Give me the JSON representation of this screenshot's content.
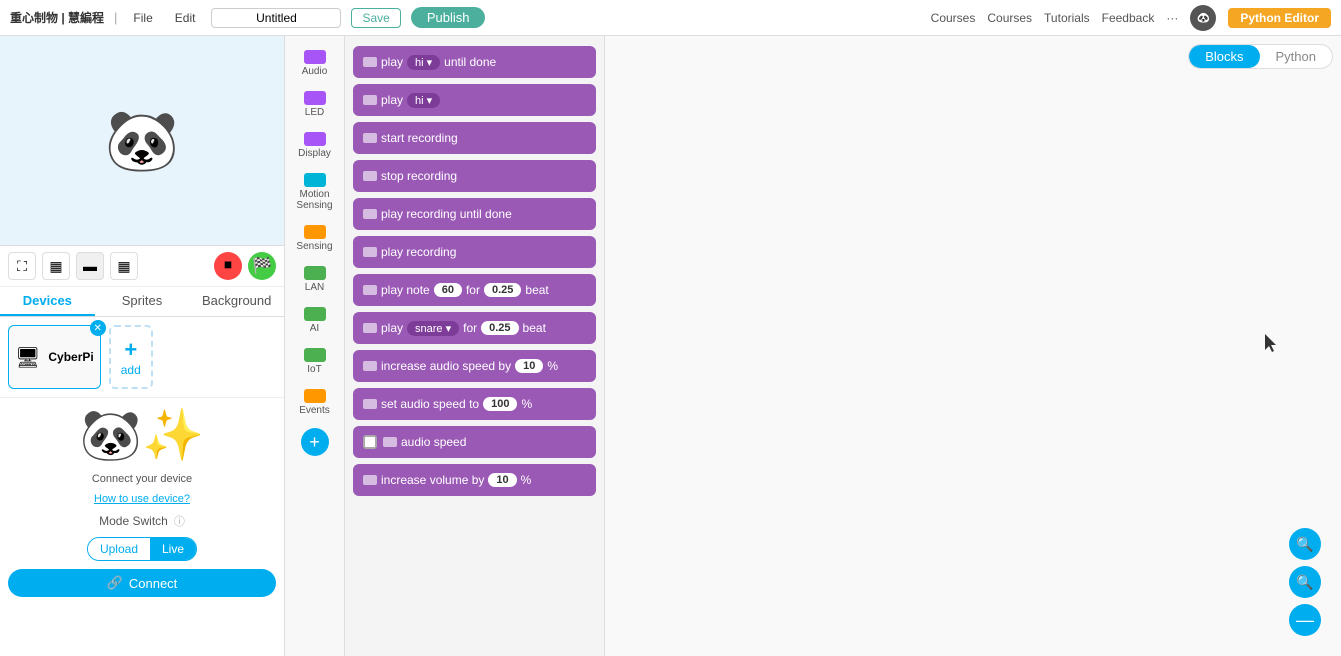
{
  "topbar": {
    "brand": "重心制物 | 慧編程",
    "file_label": "File",
    "edit_label": "Edit",
    "title_value": "Untitled",
    "save_label": "Save",
    "publish_label": "Publish",
    "courses_label": "Courses",
    "tutorials_label": "Tutorials",
    "feedback_label": "Feedback",
    "python_editor_label": "Python Editor"
  },
  "view_toggle": {
    "blocks_label": "Blocks",
    "python_label": "Python"
  },
  "tabs": {
    "devices_label": "Devices",
    "sprites_label": "Sprites",
    "background_label": "Background"
  },
  "device": {
    "name": "CyberPi",
    "add_label": "add"
  },
  "right_panel": {
    "connect_hint": "Connect your device",
    "how_to": "How to use device?",
    "mode_switch": "Mode Switch",
    "upload_label": "Upload",
    "live_label": "Live",
    "connect_label": "Connect"
  },
  "block_categories": [
    {
      "id": "audio",
      "label": "Audio",
      "color": "cat-audio"
    },
    {
      "id": "led",
      "label": "LED",
      "color": "cat-led"
    },
    {
      "id": "display",
      "label": "Display",
      "color": "cat-display"
    },
    {
      "id": "motion",
      "label": "Motion\nSensing",
      "color": "cat-motion"
    },
    {
      "id": "sensing",
      "label": "Sensing",
      "color": "cat-sensing"
    },
    {
      "id": "lan",
      "label": "LAN",
      "color": "cat-lan"
    },
    {
      "id": "ai",
      "label": "AI",
      "color": "cat-ai"
    },
    {
      "id": "iot",
      "label": "IoT",
      "color": "cat-iot"
    },
    {
      "id": "events",
      "label": "Events",
      "color": "cat-events"
    }
  ],
  "blocks": [
    {
      "id": "play-hi-until",
      "text": "play",
      "dropdown": "hi ▾",
      "suffix": "until done"
    },
    {
      "id": "play-hi",
      "text": "play",
      "dropdown": "hi ▾"
    },
    {
      "id": "start-recording",
      "text": "start recording"
    },
    {
      "id": "stop-recording",
      "text": "stop recording"
    },
    {
      "id": "play-recording-until",
      "text": "play recording until done"
    },
    {
      "id": "play-recording",
      "text": "play recording"
    },
    {
      "id": "play-note",
      "text": "play note",
      "pill1": "60",
      "mid1": "for",
      "pill2": "0.25",
      "suffix": "beat"
    },
    {
      "id": "play-snare",
      "text": "play",
      "dropdown": "snare ▾",
      "mid1": "for",
      "pill2": "0.25",
      "suffix": "beat"
    },
    {
      "id": "increase-audio-speed",
      "text": "increase audio speed by",
      "pill1": "10",
      "suffix": "%"
    },
    {
      "id": "set-audio-speed",
      "text": "set audio speed to",
      "pill1": "100",
      "suffix": "%"
    },
    {
      "id": "audio-speed",
      "text": "audio speed",
      "has_checkbox": true
    },
    {
      "id": "increase-volume",
      "text": "increase volume by",
      "pill1": "10",
      "suffix": "%"
    }
  ],
  "zoom": {
    "in_icon": "🔍",
    "out_icon": "🔍",
    "minus_icon": "—"
  }
}
